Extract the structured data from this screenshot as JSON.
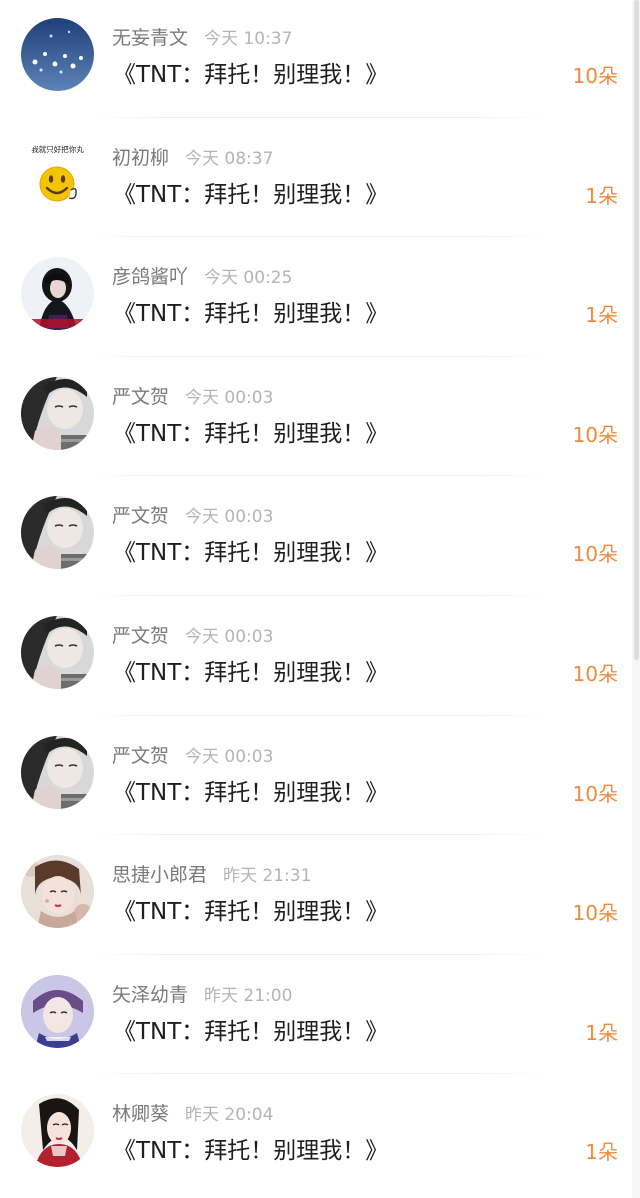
{
  "rows": [
    {
      "name": "无妄青文",
      "time": "今天 10:37",
      "title": "《TNT：拜托！别理我！》",
      "flowers": "10朵"
    },
    {
      "name": "初初柳",
      "time": "今天 08:37",
      "title": "《TNT：拜托！别理我！》",
      "flowers": "1朵",
      "avatar_text": "我就只好把你丸"
    },
    {
      "name": "彦鸽酱吖",
      "time": "今天 00:25",
      "title": "《TNT：拜托！别理我！》",
      "flowers": "1朵"
    },
    {
      "name": "严文贺",
      "time": "今天 00:03",
      "title": "《TNT：拜托！别理我！》",
      "flowers": "10朵"
    },
    {
      "name": "严文贺",
      "time": "今天 00:03",
      "title": "《TNT：拜托！别理我！》",
      "flowers": "10朵"
    },
    {
      "name": "严文贺",
      "time": "今天 00:03",
      "title": "《TNT：拜托！别理我！》",
      "flowers": "10朵"
    },
    {
      "name": "严文贺",
      "time": "今天 00:03",
      "title": "《TNT：拜托！别理我！》",
      "flowers": "10朵"
    },
    {
      "name": "思捷小郎君",
      "time": "昨天 21:31",
      "title": "《TNT：拜托！别理我！》",
      "flowers": "10朵"
    },
    {
      "name": "矢泽幼青",
      "time": "昨天 21:00",
      "title": "《TNT：拜托！别理我！》",
      "flowers": "1朵"
    },
    {
      "name": "林卿葵",
      "time": "昨天 20:04",
      "title": "《TNT：拜托！别理我！》",
      "flowers": "1朵"
    }
  ],
  "colors": {
    "flower_accent": "#f08a3c",
    "name_text": "#7a7a7a",
    "time_text": "#b4b4b4",
    "title_text": "#1f1f1f"
  }
}
